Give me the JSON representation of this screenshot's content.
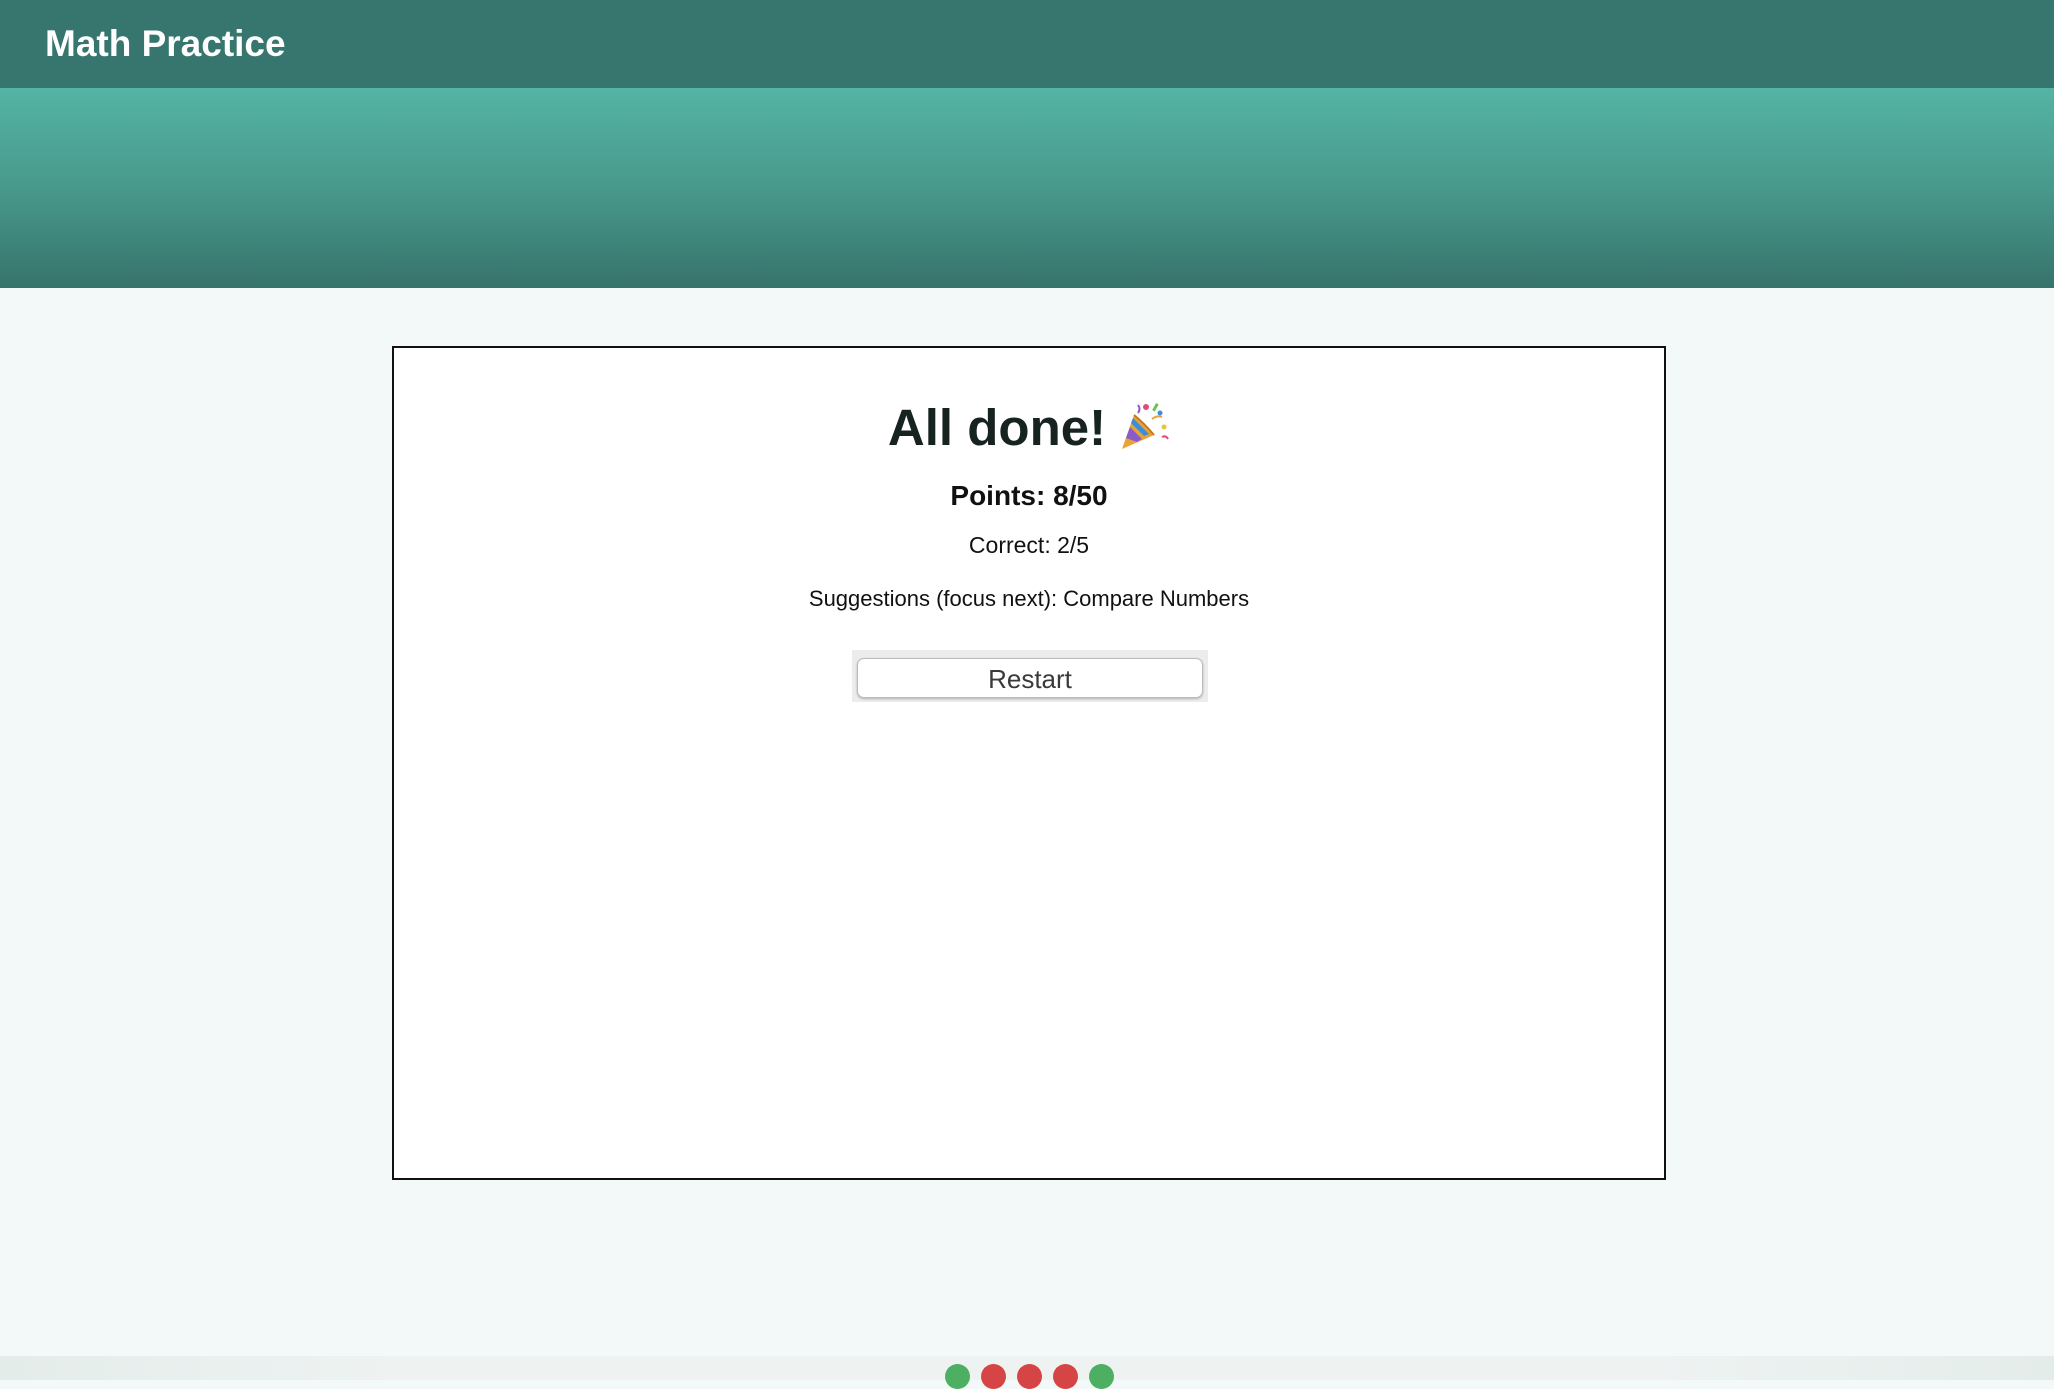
{
  "header": {
    "title": "Math Practice"
  },
  "results": {
    "heading": "All done!",
    "heading_icon": "party-popper-icon",
    "points": "Points: 8/50",
    "correct": "Correct: 2/5",
    "suggestions": "Suggestions (focus next): Compare Numbers",
    "restart_label": "Restart"
  },
  "progress": {
    "answers": [
      "correct",
      "wrong",
      "wrong",
      "wrong",
      "correct"
    ]
  },
  "colors": {
    "header_bg": "#36766e",
    "hero_top": "#54b4a4",
    "hero_bottom": "#36736b",
    "page_bg": "#f2f9f8",
    "correct": "#4caf62",
    "wrong": "#d64545"
  }
}
